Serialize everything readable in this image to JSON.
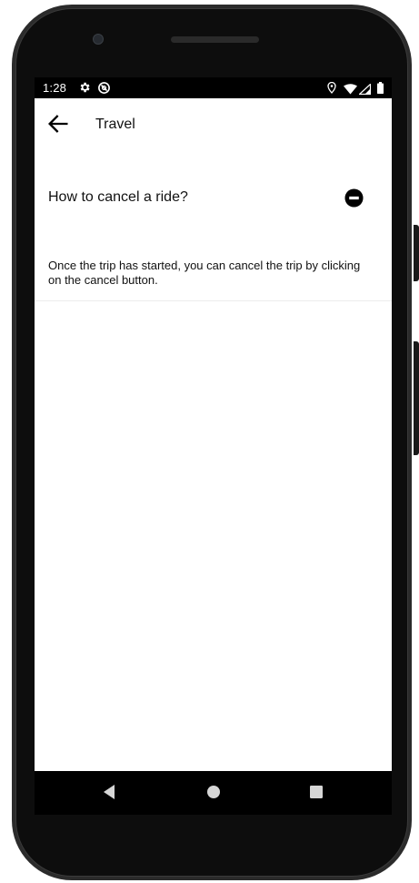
{
  "status_bar": {
    "time": "1:28",
    "icons": [
      "gear-icon",
      "sync-icon",
      "location-icon",
      "wifi-icon",
      "signal-icon",
      "battery-icon"
    ]
  },
  "app_bar": {
    "title": "Travel",
    "back_icon": "arrow-left-icon"
  },
  "faq": {
    "items": [
      {
        "question": "How to cancel a ride?",
        "answer": "Once the trip has started, you can cancel the trip by clicking on the cancel button.",
        "expanded": true,
        "toggle_icon": "minus-circle-icon"
      }
    ]
  },
  "nav_bar": {
    "icons": [
      "nav-back-icon",
      "nav-home-icon",
      "nav-recents-icon"
    ]
  },
  "colors": {
    "background": "#ffffff",
    "status_bar": "#000000",
    "text": "#111111",
    "divider": "#ececec"
  }
}
